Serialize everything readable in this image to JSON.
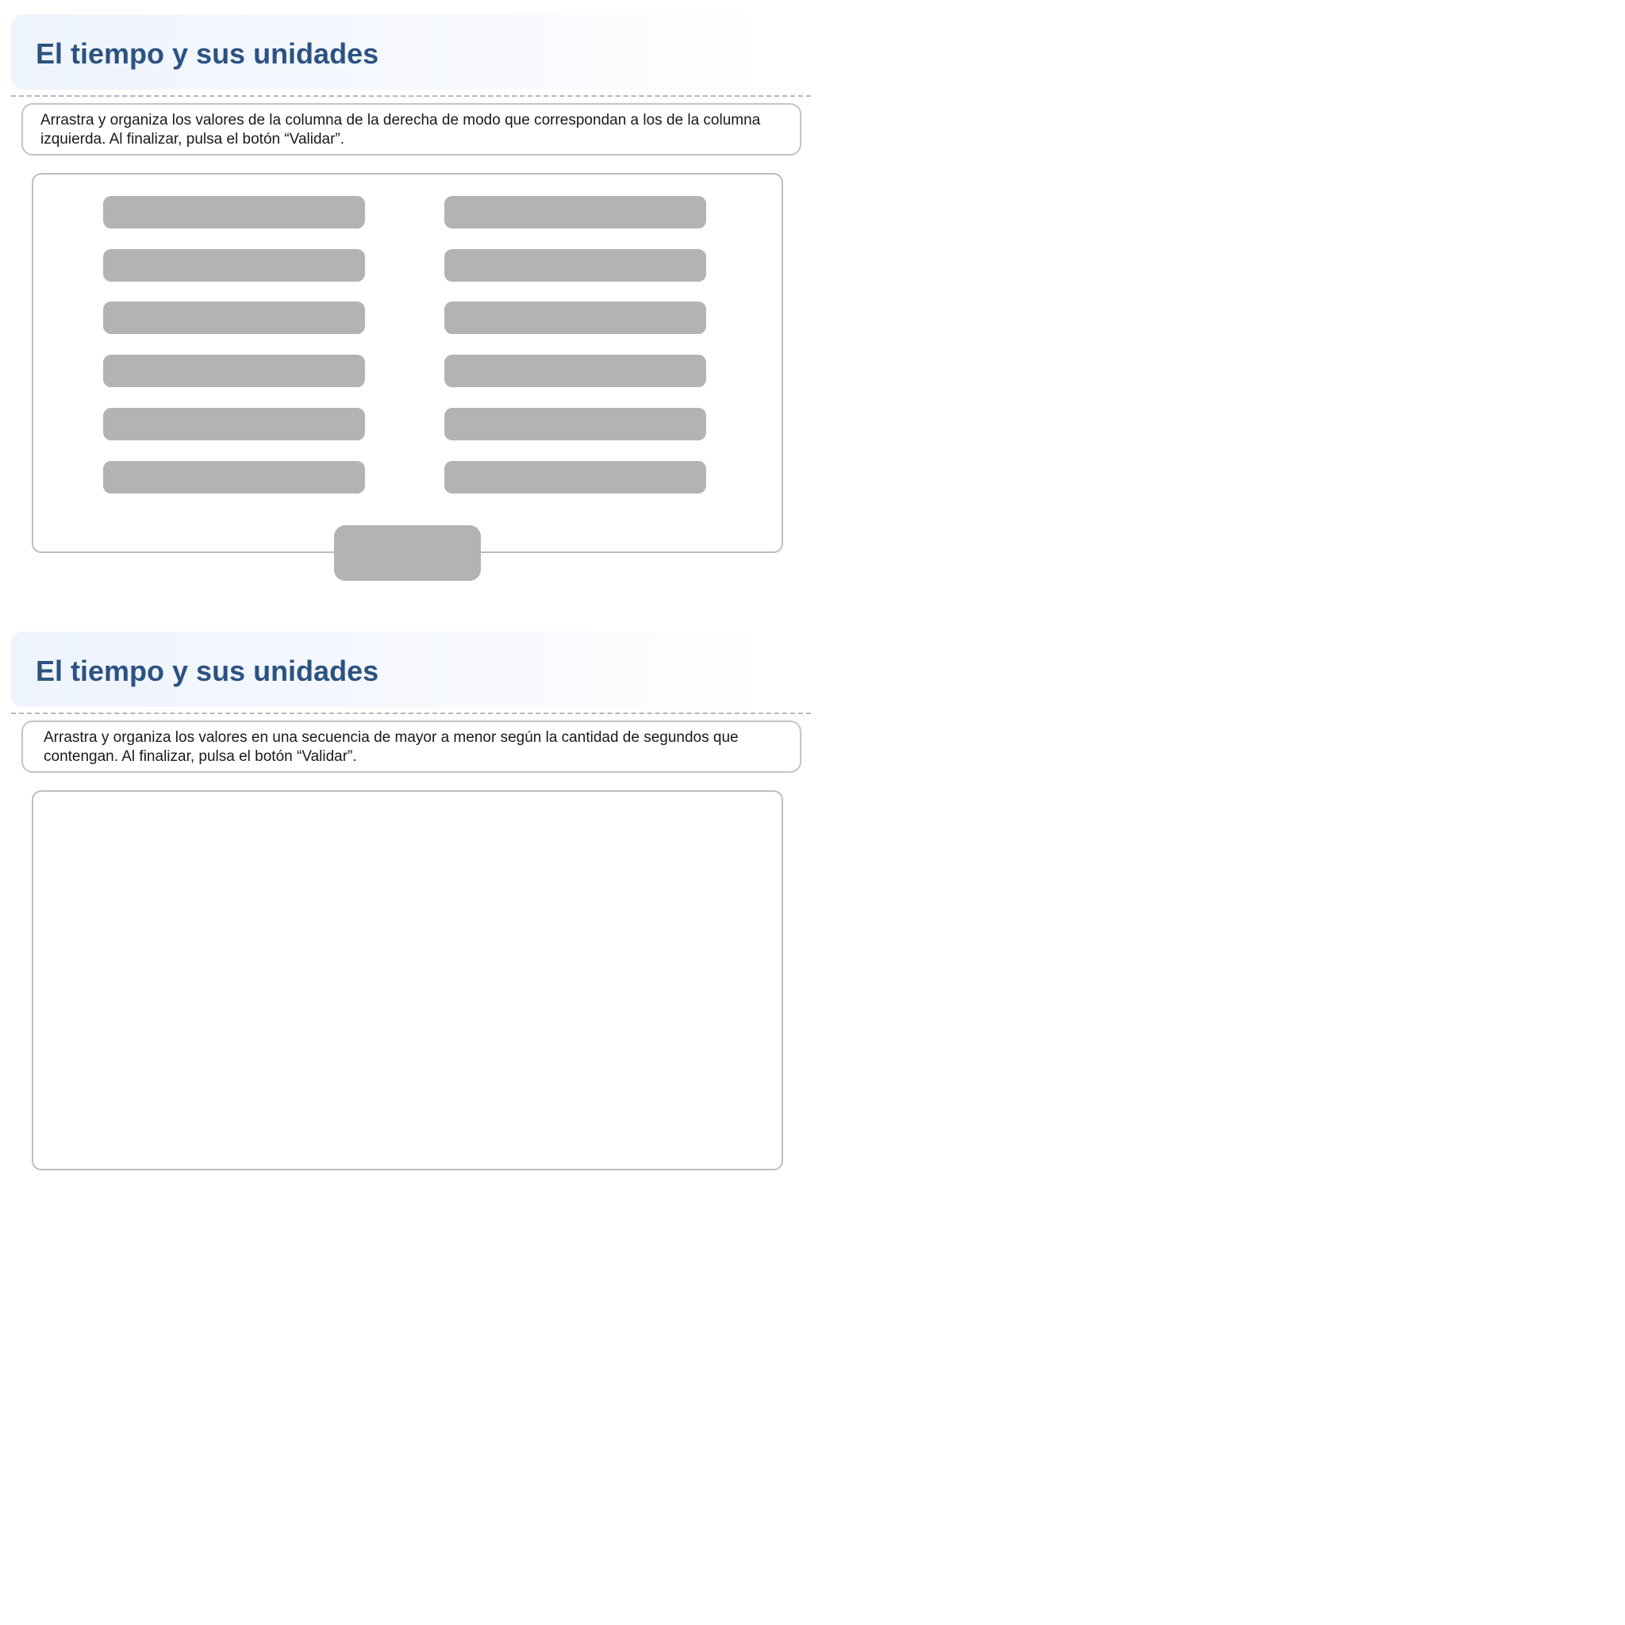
{
  "activity_1": {
    "title": "El tiempo y sus unidades",
    "instructions": "Arrastra y organiza los valores de la columna de la derecha de modo que correspondan a los de la columna izquierda. Al finalizar, pulsa el botón “Validar”.",
    "left_items": [
      "",
      "",
      "",
      "",
      "",
      ""
    ],
    "right_items": [
      "",
      "",
      "",
      "",
      "",
      ""
    ],
    "validate_label": ""
  },
  "activity_2": {
    "title": "El tiempo y sus unidades",
    "instructions": "Arrastra y organiza los valores en una secuencia de mayor a menor según la cantidad de segundos que contengan. Al finalizar, pulsa el botón “Validar”."
  },
  "colors": {
    "title": "#2c5282",
    "slot": "#b3b3b3",
    "border": "#c4c4c4"
  }
}
